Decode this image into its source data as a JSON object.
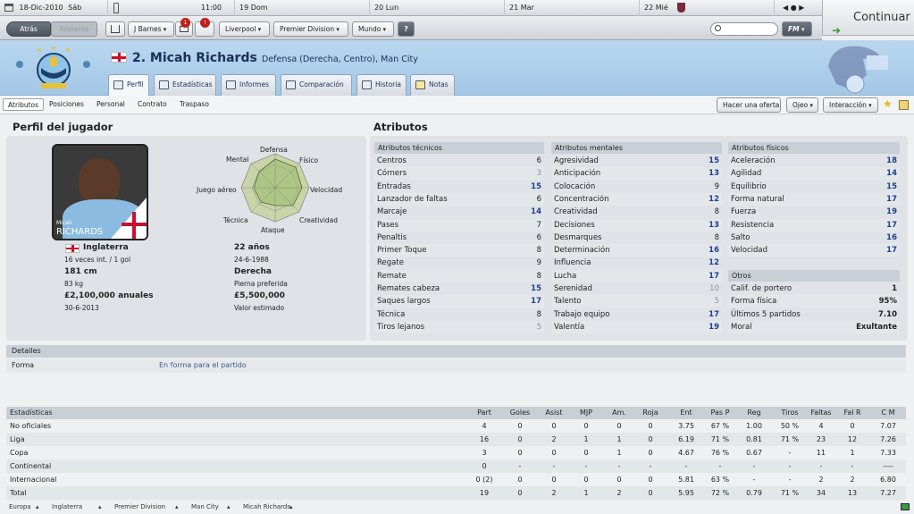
{
  "datebar": {
    "date": "18-Dic-2010",
    "day": "Sáb",
    "time": "11:00",
    "days": [
      "19 Dom",
      "20 Lun",
      "21 Mar",
      "22 Mié"
    ]
  },
  "continue_label": "Continuar",
  "toolbar": {
    "back": "Atrás",
    "forward": "Adelante",
    "manager": "J Barnes",
    "badge1": "1",
    "badge2": "!",
    "club": "Liverpool",
    "league": "Premier Division",
    "world": "Mundo",
    "help": "?",
    "fm": "FM"
  },
  "player": {
    "number_name": "2. Micah Richards",
    "position_club": "Defensa (Derecha, Centro), Man City"
  },
  "tabs": [
    "Perfil",
    "Estadísticas",
    "Informes",
    "Comparación",
    "Historia",
    "Notas"
  ],
  "subnav": [
    "Atributos",
    "Posiciones",
    "Personal",
    "Contrato",
    "Traspaso"
  ],
  "actions": {
    "offer": "Hacer una oferta",
    "eye": "Ojeo",
    "interaction": "Interacción"
  },
  "profile": {
    "title": "Perfil del jugador",
    "photo_name1": "Micah",
    "photo_name2": "RICHARDS",
    "nation": "Inglaterra",
    "caps": "16 veces int. / 1 gol",
    "age": "22 años",
    "dob": "24-6-1988",
    "height": "181 cm",
    "weight": "83 kg",
    "foot": "Derecha",
    "foot_label": "Pierna preferida",
    "wage": "£2,100,000 anuales",
    "contract_end": "30-6-2013",
    "value": "£5,500,000",
    "value_label": "Valor estimado",
    "radar": {
      "defensa": "Defensa",
      "fisico": "Físico",
      "velocidad": "Velocidad",
      "creatividad": "Creatividad",
      "ataque": "Ataque",
      "tecnica": "Técnica",
      "juego_aereo": "Juego aéreo",
      "mental": "Mental"
    }
  },
  "attributes": {
    "title": "Atributos",
    "technical": {
      "header": "Atributos técnicos",
      "rows": [
        {
          "name": "Centros",
          "value": "6"
        },
        {
          "name": "Córners",
          "value": "3"
        },
        {
          "name": "Entradas",
          "value": "15"
        },
        {
          "name": "Lanzador de faltas",
          "value": "6"
        },
        {
          "name": "Marcaje",
          "value": "14"
        },
        {
          "name": "Pases",
          "value": "7"
        },
        {
          "name": "Penaltis",
          "value": "6"
        },
        {
          "name": "Primer Toque",
          "value": "8"
        },
        {
          "name": "Regate",
          "value": "9"
        },
        {
          "name": "Remate",
          "value": "8"
        },
        {
          "name": "Remates cabeza",
          "value": "15"
        },
        {
          "name": "Saques largos",
          "value": "17"
        },
        {
          "name": "Técnica",
          "value": "8"
        },
        {
          "name": "Tiros lejanos",
          "value": "5"
        }
      ]
    },
    "mental": {
      "header": "Atributos mentales",
      "rows": [
        {
          "name": "Agresividad",
          "value": "15"
        },
        {
          "name": "Anticipación",
          "value": "13"
        },
        {
          "name": "Colocación",
          "value": "9"
        },
        {
          "name": "Concentración",
          "value": "12"
        },
        {
          "name": "Creatividad",
          "value": "8"
        },
        {
          "name": "Decisiones",
          "value": "13"
        },
        {
          "name": "Desmarques",
          "value": "8"
        },
        {
          "name": "Determinación",
          "value": "16"
        },
        {
          "name": "Influencia",
          "value": "12"
        },
        {
          "name": "Lucha",
          "value": "17"
        },
        {
          "name": "Serenidad",
          "value": "10"
        },
        {
          "name": "Talento",
          "value": "5"
        },
        {
          "name": "Trabajo equipo",
          "value": "17"
        },
        {
          "name": "Valentía",
          "value": "19"
        }
      ]
    },
    "physical": {
      "header": "Atributos físicos",
      "rows": [
        {
          "name": "Aceleración",
          "value": "18"
        },
        {
          "name": "Agilidad",
          "value": "14"
        },
        {
          "name": "Equilibrio",
          "value": "15"
        },
        {
          "name": "Forma natural",
          "value": "17"
        },
        {
          "name": "Fuerza",
          "value": "19"
        },
        {
          "name": "Resistencia",
          "value": "17"
        },
        {
          "name": "Salto",
          "value": "16"
        },
        {
          "name": "Velocidad",
          "value": "17"
        }
      ]
    },
    "other": {
      "header": "Otros",
      "rows": [
        {
          "name": "Calif. de portero",
          "value": "1"
        },
        {
          "name": "Forma física",
          "value": "95%"
        },
        {
          "name": "Últimos 5 partidos",
          "value": "7.10"
        },
        {
          "name": "Moral",
          "value": "Exultante"
        }
      ]
    }
  },
  "details": {
    "header": "Detalles",
    "label": "Forma",
    "value": "En forma para el partido"
  },
  "stats": {
    "columns": [
      "Estadísticas",
      "Part",
      "Goles",
      "Asist",
      "MJP",
      "Am.",
      "Roja",
      "Ent",
      "Pas P",
      "Reg",
      "Tiros",
      "Faltas",
      "Fal R",
      "C M"
    ],
    "rows": [
      [
        "No oficiales",
        "4",
        "0",
        "0",
        "0",
        "0",
        "0",
        "3.75",
        "67 %",
        "1.00",
        "50 %",
        "4",
        "0",
        "7.07"
      ],
      [
        "Liga",
        "16",
        "0",
        "2",
        "1",
        "1",
        "0",
        "6.19",
        "71 %",
        "0.81",
        "71 %",
        "23",
        "12",
        "7.26"
      ],
      [
        "Copa",
        "3",
        "0",
        "0",
        "0",
        "1",
        "0",
        "4.67",
        "76 %",
        "0.67",
        "-",
        "11",
        "1",
        "7.33"
      ],
      [
        "Continental",
        "0",
        "-",
        "-",
        "-",
        "-",
        "-",
        "-",
        "-",
        "-",
        "-",
        "-",
        "-",
        "----"
      ],
      [
        "Internacional",
        "0 (2)",
        "0",
        "0",
        "0",
        "0",
        "0",
        "5.81",
        "63 %",
        "-",
        "-",
        "2",
        "2",
        "6.80"
      ],
      [
        "Total",
        "19",
        "0",
        "2",
        "1",
        "2",
        "0",
        "5.95",
        "72 %",
        "0.79",
        "71 %",
        "34",
        "13",
        "7.27"
      ]
    ]
  },
  "breadcrumb": [
    "Europa",
    "Inglaterra",
    "Premier Division",
    "Man City",
    "Micah Richards"
  ]
}
